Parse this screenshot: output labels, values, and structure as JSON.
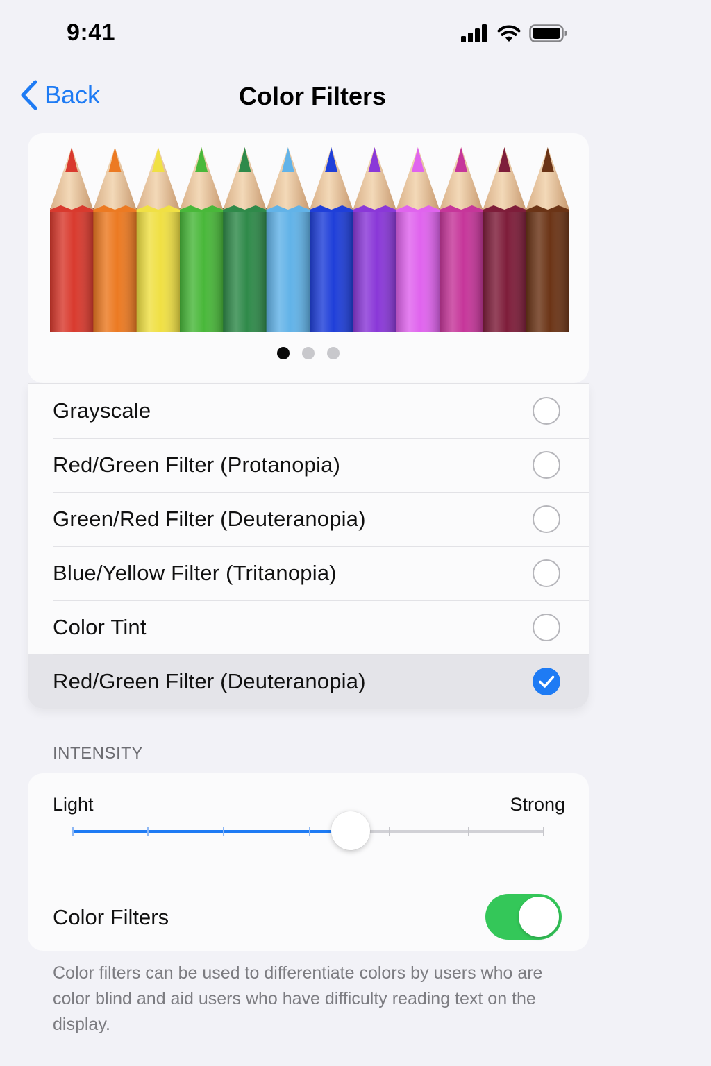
{
  "status_bar": {
    "time": "9:41",
    "icons": [
      "cellular-signal-icon",
      "wifi-icon",
      "battery-icon"
    ]
  },
  "nav": {
    "back_label": "Back",
    "title": "Color Filters"
  },
  "preview": {
    "pencil_colors": [
      "#d93a2e",
      "#ec7a22",
      "#f0e044",
      "#49b83a",
      "#2f8a4a",
      "#62b3e8",
      "#1f3fd9",
      "#8a38d8",
      "#e064ee",
      "#c6369a",
      "#7e1d3a",
      "#6b3416"
    ],
    "page_dots": 3,
    "active_page": 1
  },
  "filters": {
    "options": [
      {
        "label": "Grayscale",
        "selected": false
      },
      {
        "label": "Red/Green Filter (Protanopia)",
        "selected": false
      },
      {
        "label": "Green/Red Filter (Deuteranopia)",
        "selected": false
      },
      {
        "label": "Blue/Yellow Filter (Tritanopia)",
        "selected": false
      },
      {
        "label": "Color Tint",
        "selected": false
      },
      {
        "label": "Red/Green Filter (Deuteranopia)",
        "selected": true
      }
    ]
  },
  "intensity": {
    "header": "INTENSITY",
    "min_label": "Light",
    "max_label": "Strong",
    "value": 0.59
  },
  "color_filters_toggle": {
    "label": "Color Filters",
    "on": true
  },
  "footer": "Color filters can be used to differentiate colors by users who are color blind and aid users who have difficulty reading text on the display.",
  "colors": {
    "accent": "#1e7bf4",
    "toggle_on": "#34c759",
    "background": "#f2f2f7"
  }
}
